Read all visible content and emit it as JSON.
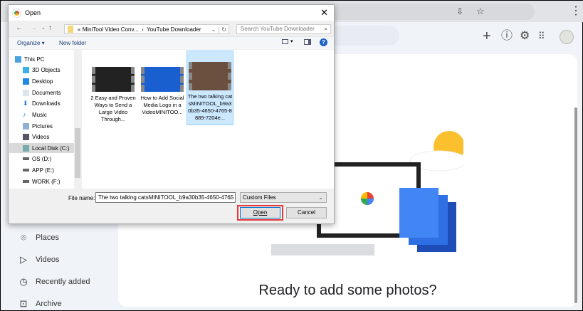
{
  "browser": {
    "icons": [
      "install-icon",
      "star-icon",
      "menu-icon"
    ]
  },
  "photos": {
    "header_icons": [
      "plus-icon",
      "help-icon",
      "gear-icon",
      "apps-icon",
      "avatar"
    ],
    "sidebar": [
      {
        "label": "Places",
        "icon": "place-icon"
      },
      {
        "label": "Videos",
        "icon": "play-icon"
      },
      {
        "label": "Recently added",
        "icon": "clock-icon"
      },
      {
        "label": "Archive",
        "icon": "archive-icon"
      }
    ],
    "empty_title": "Ready to add some photos?"
  },
  "dialog": {
    "title": "Open",
    "breadcrumb": {
      "prefix": "«",
      "parent": "MiniTool Video Conv...",
      "sep": "›",
      "current": "YouTube Downloader"
    },
    "search_placeholder": "Search YouTube Downloader",
    "organize": "Organize ▾",
    "new_folder": "New folder",
    "nav": [
      {
        "label": "This PC"
      },
      {
        "label": "3D Objects"
      },
      {
        "label": "Desktop"
      },
      {
        "label": "Documents"
      },
      {
        "label": "Downloads"
      },
      {
        "label": "Music"
      },
      {
        "label": "Pictures"
      },
      {
        "label": "Videos"
      },
      {
        "label": "Local Disk (C:)",
        "selected": true
      },
      {
        "label": "OS (D:)"
      },
      {
        "label": "APP (E:)"
      },
      {
        "label": "WORK (F:)"
      }
    ],
    "files": [
      {
        "name": "2 Easy and Proven Ways to Send a Large Video Through...",
        "selected": false
      },
      {
        "name": "How to Add Social Media Logo in a VideoMINITOO...",
        "selected": false
      },
      {
        "name": "The two talking catsMINITOOL_b9a30b35-4650-4765-8889-7204e...",
        "selected": true
      }
    ],
    "file_name_label": "File name:",
    "file_name_value": "The two talking catsMINITOOL_b9a30b35-4650-4765",
    "file_type": "Custom Files",
    "open": "Open",
    "cancel": "Cancel"
  }
}
